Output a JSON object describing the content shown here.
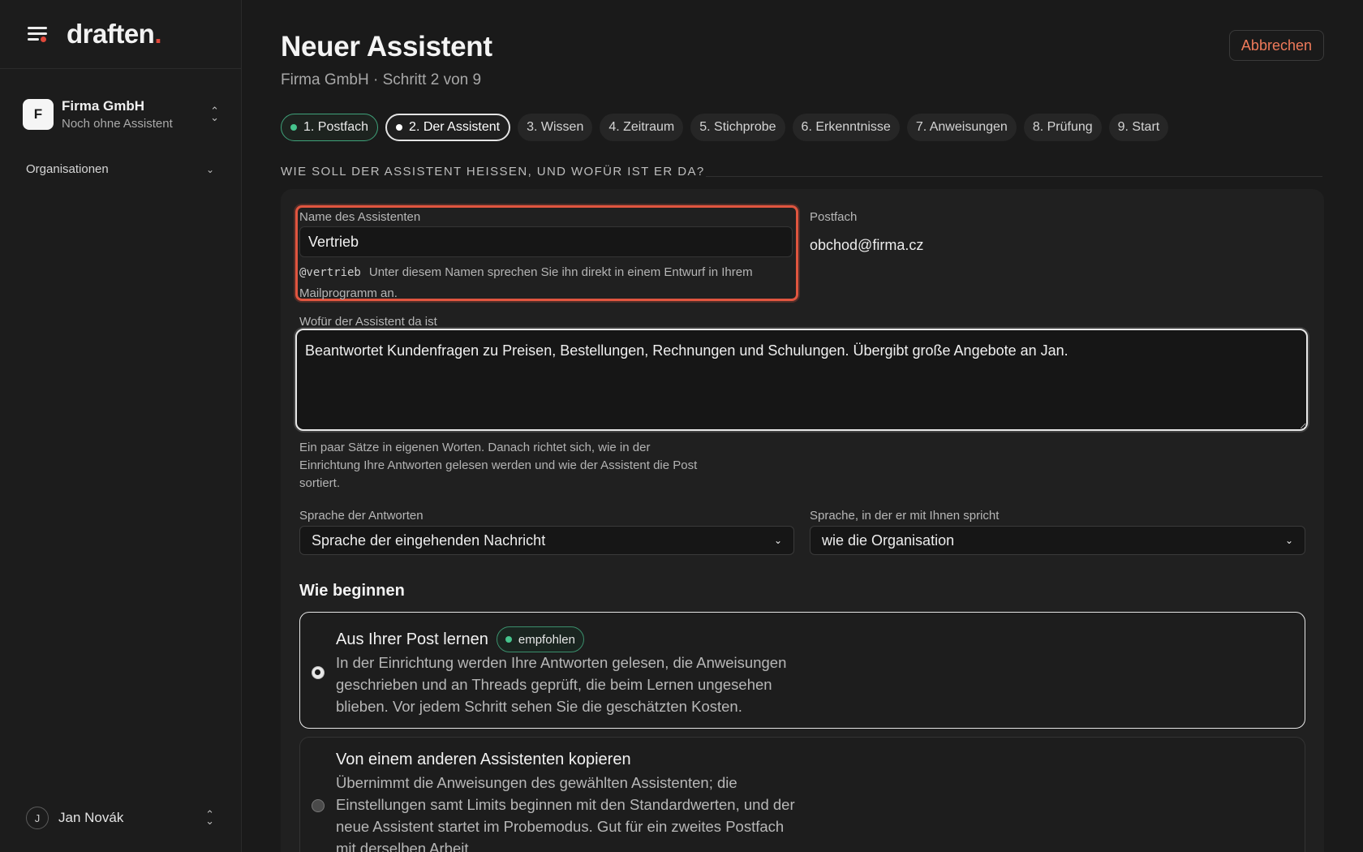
{
  "brand": {
    "logo_text": "draften",
    "logo_dot": ".",
    "accent": "#e0483a"
  },
  "sidebar": {
    "org": {
      "initial": "F",
      "name": "Firma GmbH",
      "subtitle": "Noch ohne Assistent"
    },
    "nav_group": "Organisationen",
    "user": {
      "initial": "J",
      "name": "Jan Novák"
    }
  },
  "header": {
    "title": "Neuer Assistent",
    "subtitle": "Firma GmbH · Schritt 2 von 9",
    "cancel_label": "Abbrechen"
  },
  "steps": [
    {
      "label": "1. Postfach",
      "state": "done"
    },
    {
      "label": "2. Der Assistent",
      "state": "current"
    },
    {
      "label": "3. Wissen",
      "state": "todo"
    },
    {
      "label": "4. Zeitraum",
      "state": "todo"
    },
    {
      "label": "5. Stichprobe",
      "state": "todo"
    },
    {
      "label": "6. Erkenntnisse",
      "state": "todo"
    },
    {
      "label": "7. Anweisungen",
      "state": "todo"
    },
    {
      "label": "8. Prüfung",
      "state": "todo"
    },
    {
      "label": "9. Start",
      "state": "todo"
    }
  ],
  "section_heading": "Wie soll der Assistent heißen, und wofür ist er da?",
  "form": {
    "name": {
      "label": "Name des Assistenten",
      "value": "Vertrieb",
      "handle": "@vertrieb",
      "hint": "Unter diesem Namen sprechen Sie ihn direkt in einem Entwurf in Ihrem Mailprogramm an."
    },
    "mailbox": {
      "label": "Postfach",
      "value": "obchod@firma.cz"
    },
    "purpose": {
      "label": "Wofür der Assistent da ist",
      "value": "Beantwortet Kundenfragen zu Preisen, Bestellungen, Rechnungen und Schulungen. Übergibt große Angebote an Jan.",
      "hint": "Ein paar Sätze in eigenen Worten. Danach richtet sich, wie in der Einrichtung Ihre Antworten gelesen werden und wie der Assistent die Post sortiert."
    },
    "reply_language": {
      "label": "Sprache der Antworten",
      "value": "Sprache der eingehenden Nachricht"
    },
    "talk_language": {
      "label": "Sprache, in der er mit Ihnen spricht",
      "value": "wie die Organisation"
    }
  },
  "start": {
    "heading": "Wie beginnen",
    "options": [
      {
        "title": "Aus Ihrer Post lernen",
        "badge": "empfohlen",
        "description": "In der Einrichtung werden Ihre Antworten gelesen, die Anweisungen geschrieben und an Threads geprüft, die beim Lernen ungesehen blieben. Vor jedem Schritt sehen Sie die geschätzten Kosten.",
        "selected": true
      },
      {
        "title": "Von einem anderen Assistenten kopieren",
        "description": "Übernimmt die Anweisungen des gewählten Assistenten; die Einstellungen samt Limits beginnen mit den Standardwerten, und der neue Assistent startet im Probemodus. Gut für ein zweites Postfach mit derselben Arbeit.",
        "selected": false
      }
    ]
  },
  "colors": {
    "success": "#46c48d",
    "danger_outline": "#e0553f",
    "cancel_text": "#ef7a5a"
  }
}
